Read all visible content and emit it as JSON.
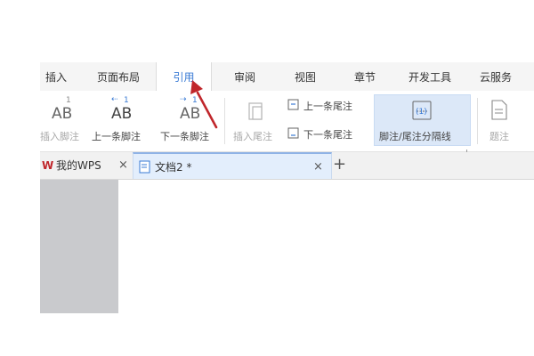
{
  "menu": {
    "tabs": [
      {
        "label": "插入",
        "active": false
      },
      {
        "label": "页面布局",
        "active": false
      },
      {
        "label": "引用",
        "active": true
      },
      {
        "label": "审阅",
        "active": false
      },
      {
        "label": "视图",
        "active": false
      },
      {
        "label": "章节",
        "active": false
      },
      {
        "label": "开发工具",
        "active": false
      },
      {
        "label": "云服务",
        "active": false
      }
    ]
  },
  "ribbon": {
    "insert_footnote": {
      "label": "插入脚注",
      "glyph": "AB",
      "sup": "1"
    },
    "prev_footnote": {
      "label": "上一条脚注",
      "glyph": "AB",
      "sup": "1"
    },
    "next_footnote": {
      "label": "下一条脚注",
      "glyph": "AB",
      "sup": "1"
    },
    "insert_endnote": {
      "label": "插入尾注"
    },
    "prev_endnote": {
      "label": "上一条尾注"
    },
    "next_endnote": {
      "label": "下一条尾注"
    },
    "separator": {
      "label": "脚注/尾注分隔线",
      "icon_text": "(1)"
    },
    "caption": {
      "label": "题注"
    }
  },
  "doc_tabs": {
    "tabs": [
      {
        "label": "我的WPS",
        "icon": "wps-logo-icon",
        "active": false
      },
      {
        "label": "文档2 *",
        "icon": "document-icon",
        "active": true
      }
    ],
    "close_glyph": "×",
    "add_glyph": "+"
  },
  "colors": {
    "accent": "#3a7bd5",
    "annotation_arrow": "#c0262b",
    "ribbon_highlight": "#dce8f8",
    "left_pane": "#c9cacd"
  }
}
